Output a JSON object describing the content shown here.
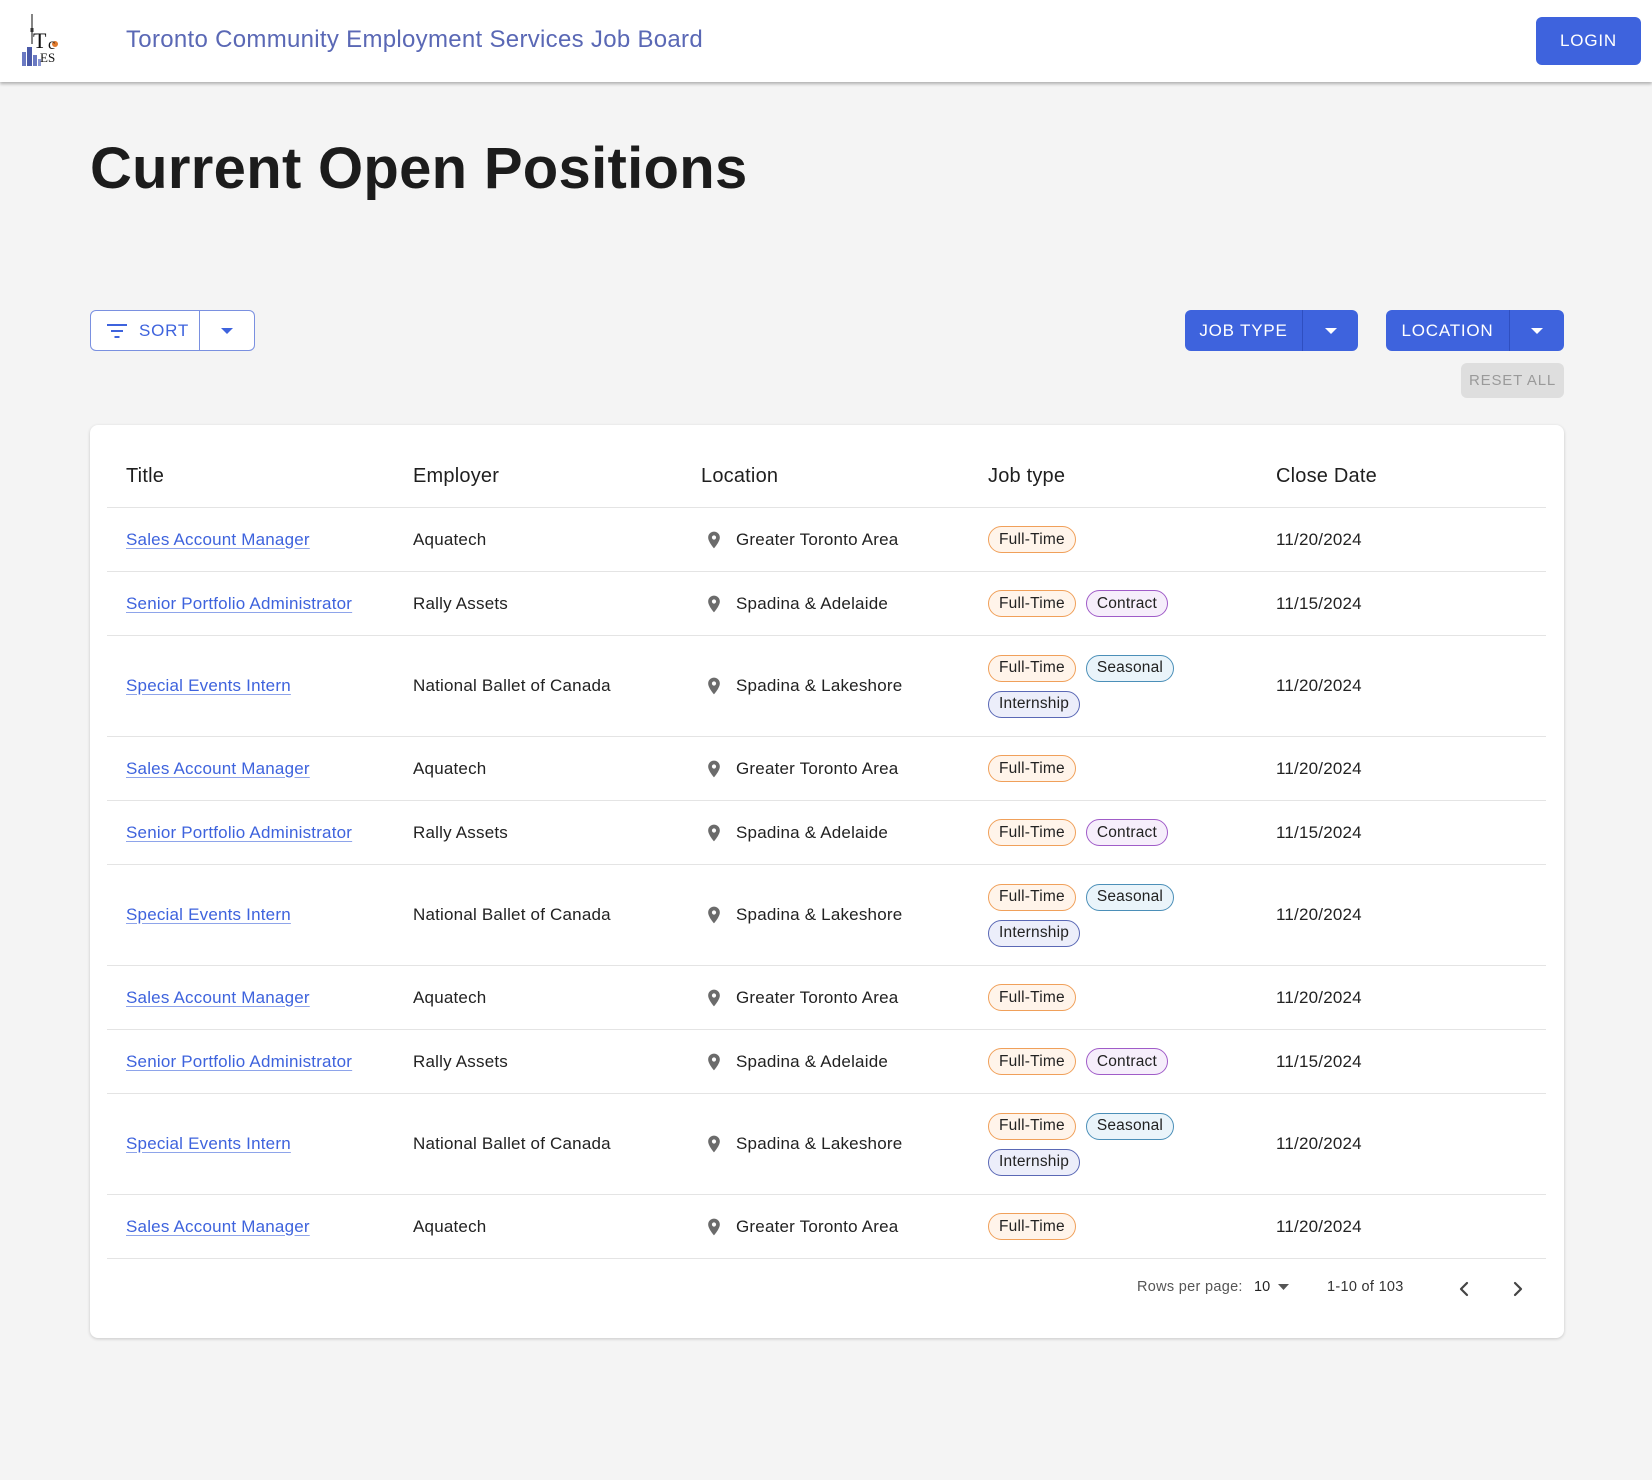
{
  "header": {
    "logo_text": {
      "t": "T",
      "c": "c",
      "es": "ES"
    },
    "app_title": "Toronto Community Employment Services Job Board",
    "login_label": "LOGIN"
  },
  "page_title": "Current Open Positions",
  "toolbar": {
    "sort_label": "SORT",
    "job_type_label": "JOB TYPE",
    "location_label": "LOCATION",
    "reset_label": "RESET ALL"
  },
  "table": {
    "headers": [
      "Title",
      "Employer",
      "Location",
      "Job type",
      "Close Date"
    ],
    "rows": [
      {
        "title": "Sales Account Manager",
        "employer": "Aquatech",
        "location": "Greater Toronto Area",
        "job_types": [
          "Full-Time"
        ],
        "close_date": "11/20/2024"
      },
      {
        "title": "Senior Portfolio Administrator",
        "employer": "Rally Assets",
        "location": "Spadina & Adelaide",
        "job_types": [
          "Full-Time",
          "Contract"
        ],
        "close_date": "11/15/2024"
      },
      {
        "title": "Special Events Intern",
        "employer": "National Ballet of Canada",
        "location": "Spadina & Lakeshore",
        "job_types": [
          "Full-Time",
          "Seasonal",
          "Internship"
        ],
        "close_date": "11/20/2024"
      },
      {
        "title": "Sales Account Manager",
        "employer": "Aquatech",
        "location": "Greater Toronto Area",
        "job_types": [
          "Full-Time"
        ],
        "close_date": "11/20/2024"
      },
      {
        "title": "Senior Portfolio Administrator",
        "employer": "Rally Assets",
        "location": "Spadina & Adelaide",
        "job_types": [
          "Full-Time",
          "Contract"
        ],
        "close_date": "11/15/2024"
      },
      {
        "title": "Special Events Intern",
        "employer": "National Ballet of Canada",
        "location": "Spadina & Lakeshore",
        "job_types": [
          "Full-Time",
          "Seasonal",
          "Internship"
        ],
        "close_date": "11/20/2024"
      },
      {
        "title": "Sales Account Manager",
        "employer": "Aquatech",
        "location": "Greater Toronto Area",
        "job_types": [
          "Full-Time"
        ],
        "close_date": "11/20/2024"
      },
      {
        "title": "Senior Portfolio Administrator",
        "employer": "Rally Assets",
        "location": "Spadina & Adelaide",
        "job_types": [
          "Full-Time",
          "Contract"
        ],
        "close_date": "11/15/2024"
      },
      {
        "title": "Special Events Intern",
        "employer": "National Ballet of Canada",
        "location": "Spadina & Lakeshore",
        "job_types": [
          "Full-Time",
          "Seasonal",
          "Internship"
        ],
        "close_date": "11/20/2024"
      },
      {
        "title": "Sales Account Manager",
        "employer": "Aquatech",
        "location": "Greater Toronto Area",
        "job_types": [
          "Full-Time"
        ],
        "close_date": "11/20/2024"
      }
    ]
  },
  "chip_colors": {
    "Full-Time": {
      "border": "#f0a05a",
      "bg": "#fff4ea"
    },
    "Contract": {
      "border": "#a05cc8",
      "bg": "#f6eefb"
    },
    "Seasonal": {
      "border": "#4b8fb8",
      "bg": "#eaf4fa"
    },
    "Internship": {
      "border": "#5a68b5",
      "bg": "#eceefa"
    }
  },
  "pagination": {
    "rows_per_page_label": "Rows per page:",
    "rows_per_page_value": "10",
    "range_text": "1-10 of 103"
  },
  "colors": {
    "primary": "#3e63dd",
    "app_title": "#5a68b5"
  }
}
